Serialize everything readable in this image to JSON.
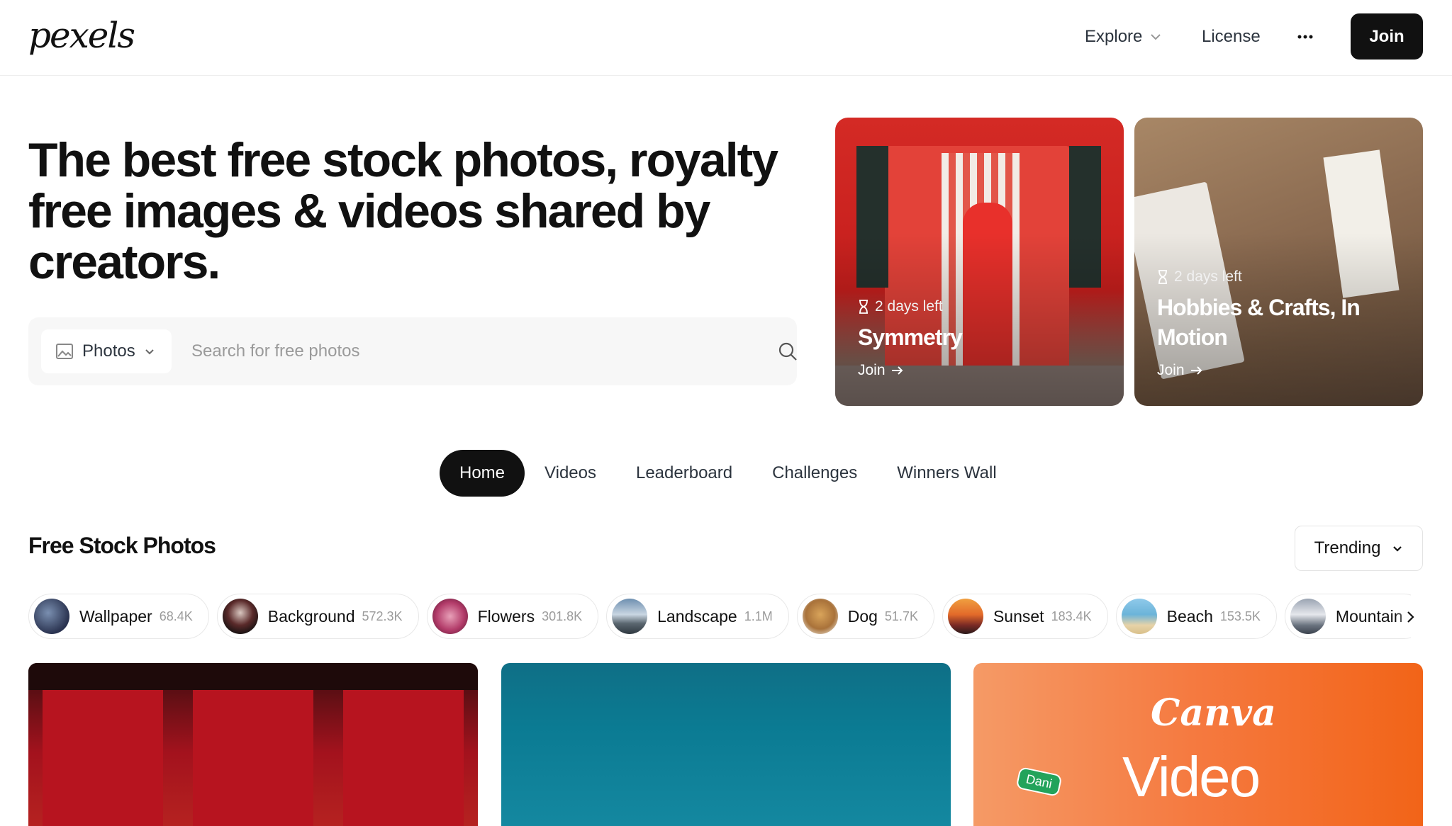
{
  "header": {
    "logo": "pexels",
    "nav": {
      "explore": "Explore",
      "license": "License",
      "more": "···",
      "join": "Join"
    }
  },
  "hero": {
    "title": "The best free stock photos, royalty free images & videos shared by creators.",
    "search": {
      "type_label": "Photos",
      "placeholder": "Search for free photos"
    }
  },
  "challenges": [
    {
      "days_left": "2 days left",
      "title": "Symmetry",
      "join": "Join"
    },
    {
      "days_left": "2 days left",
      "title": "Hobbies & Crafts, In Motion",
      "join": "Join"
    }
  ],
  "tabs": [
    "Home",
    "Videos",
    "Leaderboard",
    "Challenges",
    "Winners Wall"
  ],
  "active_tab": "Home",
  "section": {
    "title": "Free Stock Photos",
    "sort": "Trending"
  },
  "chips": [
    {
      "name": "Wallpaper",
      "count": "68.4K"
    },
    {
      "name": "Background",
      "count": "572.3K"
    },
    {
      "name": "Flowers",
      "count": "301.8K"
    },
    {
      "name": "Landscape",
      "count": "1.1M"
    },
    {
      "name": "Dog",
      "count": "51.7K"
    },
    {
      "name": "Sunset",
      "count": "183.4K"
    },
    {
      "name": "Beach",
      "count": "153.5K"
    },
    {
      "name": "Mountain",
      "count": ""
    }
  ],
  "photos": {
    "canva_brand": "Canva",
    "canva_text": "Video",
    "dani_tag": "Dani"
  },
  "colors": {
    "primary_dark": "#111111",
    "text": "#2c343e",
    "muted": "#9b9b9b"
  }
}
